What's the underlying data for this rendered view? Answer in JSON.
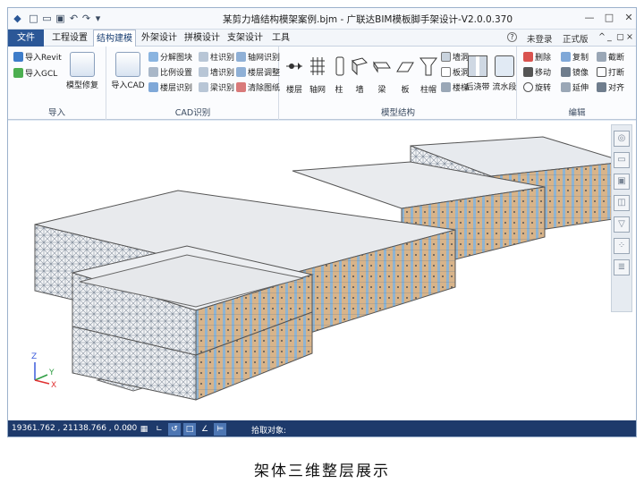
{
  "app": {
    "title": "某剪力墙结构模架案例.bjm - 广联达BIM模板脚手架设计-V2.0.0.370",
    "quick_access": [
      "app-logo-icon",
      "new-icon",
      "open-icon",
      "save-icon",
      "undo-icon",
      "redo-icon",
      "dropdown-icon"
    ],
    "window_controls": [
      "minimize-icon",
      "restore-icon",
      "close-icon"
    ]
  },
  "menu": {
    "tabs": [
      "文件",
      "工程设置",
      "结构建模",
      "外架设计",
      "拼模设计",
      "支架设计",
      "工具"
    ],
    "active_tab": "结构建模",
    "help": "?",
    "login": "未登录",
    "edition": "正式版",
    "right_icons": [
      "collapse-icon",
      "minimize-icon",
      "restore-icon",
      "close-icon"
    ]
  },
  "ribbon": {
    "import_group": {
      "label": "导入",
      "revit": "导入Revit",
      "gcl": "导入GCL",
      "repair": "模型修复"
    },
    "cad_group": {
      "label": "CAD识别",
      "import_cad": "导入CAD",
      "col1": [
        "分解图块",
        "比例设置",
        "楼层识别"
      ],
      "col2": [
        "柱识别",
        "墙识别",
        "梁识别"
      ],
      "col3": [
        "轴网识别",
        "楼层调整",
        "清除图纸"
      ]
    },
    "struct_group": {
      "label": "模型结构",
      "tools": [
        "楼层",
        "轴网",
        "柱",
        "墙",
        "梁",
        "板",
        "柱帽"
      ],
      "stack": [
        "墙洞",
        "板洞",
        "楼梯"
      ],
      "extra": [
        "后浇带",
        "流水段"
      ]
    },
    "edit_group": {
      "label": "编辑",
      "col1": [
        "删除",
        "移动",
        "旋转"
      ],
      "col2": [
        "复制",
        "镜像",
        "延伸"
      ],
      "col3": [
        "截断",
        "打断",
        "对齐"
      ]
    }
  },
  "status": {
    "coords": "19361.762 , 21138.766 , 0.000",
    "pick_label": "拾取对象:",
    "buttons": [
      "grid-icon",
      "ortho-icon",
      "axis-icon",
      "snap-icon",
      "box-icon",
      "angle-icon",
      "layer-icon"
    ]
  },
  "viewport": {
    "axis_labels": [
      "Z",
      "Y",
      "X"
    ]
  },
  "side_tools": [
    "view-3d-icon",
    "cube-top-icon",
    "cube-front-icon",
    "cube-side-icon",
    "filter-icon",
    "dots-icon",
    "layers-icon"
  ],
  "caption": "架体三维整层展示",
  "colors": {
    "file_tab": "#2b5797",
    "status_bar": "#1e3a6b",
    "slab": "#eef0f2",
    "wall": "#d8b48a",
    "frame": "#6f7d8d"
  }
}
